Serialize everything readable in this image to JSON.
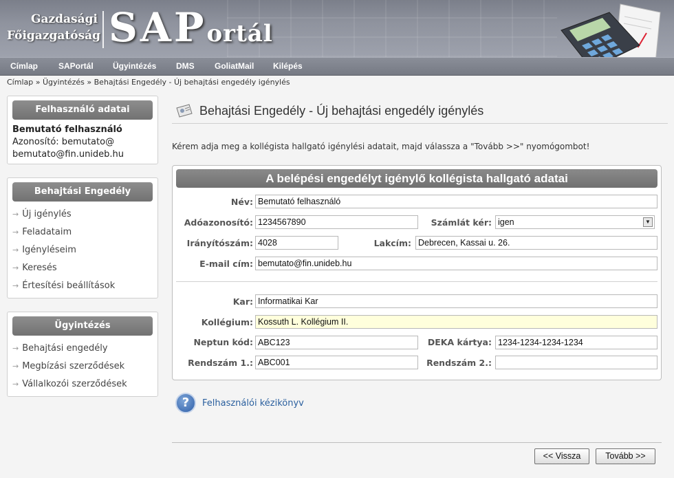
{
  "header": {
    "logo_line1": "Gazdasági",
    "logo_line2": "Főigazgatóság",
    "logo_big_sa": "SAP",
    "logo_big_rest": "ortál"
  },
  "nav": {
    "items": [
      "Címlap",
      "SAPortál",
      "Ügyintézés",
      "DMS",
      "GoliatMail",
      "Kilépés"
    ]
  },
  "breadcrumb": {
    "home": "Címlap",
    "sep": "»",
    "section": "Ügyintézés",
    "current": "Behajtási Engedély - Új behajtási engedély igénylés"
  },
  "user_box": {
    "title": "Felhasználó adatai",
    "name": "Bemutató felhasználó",
    "id_line": "Azonosító: bemutato@",
    "id_line2": "bemutato@fin.unideb.hu"
  },
  "permit_box": {
    "title": "Behajtási Engedély",
    "links": [
      "Új igénylés",
      "Feladataim",
      "Igényléseim",
      "Keresés",
      "Értesítési beállítások"
    ]
  },
  "admin_box": {
    "title": "Ügyintézés",
    "links": [
      "Behajtási engedély",
      "Megbízási szerződések",
      "Vállalkozói szerződések"
    ]
  },
  "page": {
    "title": "Behajtási Engedély - Új behajtási engedély igénylés",
    "instruction": "Kérem adja meg a kollégista hallgató igénylési adatait, majd válassza a \"Tovább >>\" nyomógombot!"
  },
  "form": {
    "heading": "A belépési engedélyt igénylő kollégista hallgató adatai",
    "labels": {
      "name": "Név:",
      "tax_id": "Adóazonosító:",
      "invoice": "Számlát kér:",
      "zip": "Irányítószám:",
      "address": "Lakcím:",
      "email": "E-mail cím:",
      "faculty": "Kar:",
      "dormitory": "Kollégium:",
      "neptun": "Neptun kód:",
      "deka": "DEKA kártya:",
      "plate1": "Rendszám 1.:",
      "plate2": "Rendszám 2.:"
    },
    "values": {
      "name": "Bemutató felhasználó",
      "tax_id": "1234567890",
      "invoice": "igen",
      "zip": "4028",
      "address": "Debrecen, Kassai u. 26.",
      "email": "bemutato@fin.unideb.hu",
      "faculty": "Informatikai Kar",
      "dormitory": "Kossuth L. Kollégium II.",
      "neptun": "ABC123",
      "deka": "1234-1234-1234-1234",
      "plate1": "ABC001",
      "plate2": ""
    }
  },
  "help": {
    "icon": "?",
    "label": "Felhasználói kézikönyv"
  },
  "buttons": {
    "back": "<< Vissza",
    "next": "Tovább >>"
  },
  "colors": {
    "header_bg": "#8f939e",
    "box_head": "#7f7f7f",
    "link": "#2a5f9e",
    "highlight_field": "#ffffdc"
  }
}
